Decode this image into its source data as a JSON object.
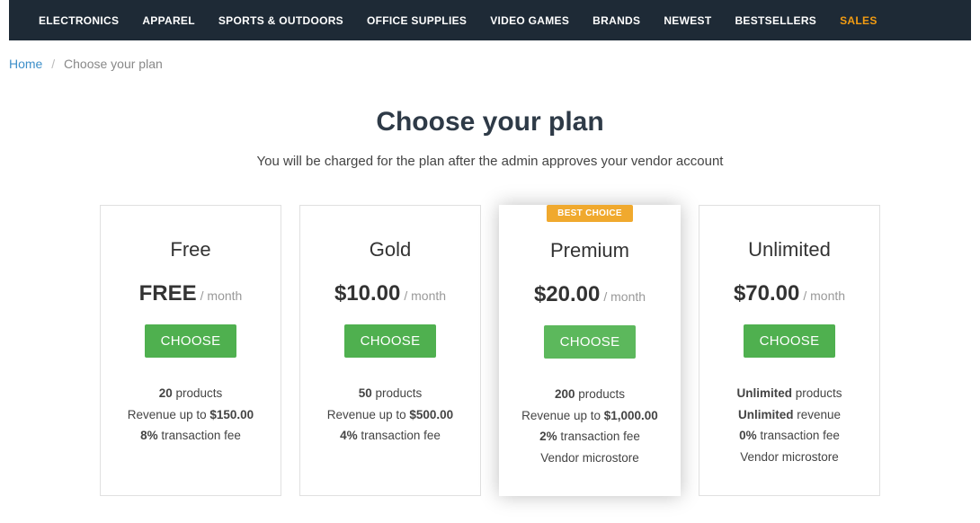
{
  "nav": {
    "items": [
      {
        "label": "ELECTRONICS"
      },
      {
        "label": "APPAREL"
      },
      {
        "label": "SPORTS & OUTDOORS"
      },
      {
        "label": "OFFICE SUPPLIES"
      },
      {
        "label": "VIDEO GAMES"
      },
      {
        "label": "BRANDS"
      },
      {
        "label": "NEWEST"
      },
      {
        "label": "BESTSELLERS"
      },
      {
        "label": "SALES",
        "highlight": true
      }
    ]
  },
  "breadcrumb": {
    "home": "Home",
    "current": "Choose your plan"
  },
  "page": {
    "title": "Choose your plan",
    "subtitle": "You will be charged for the plan after the admin approves your vendor account"
  },
  "plans": [
    {
      "name": "Free",
      "price": "FREE",
      "period": "/ month",
      "choose": "CHOOSE",
      "features": [
        {
          "bold": "20",
          "text": " products"
        },
        {
          "pre": "Revenue up to ",
          "bold": "$150.00"
        },
        {
          "bold": "8%",
          "text": " transaction fee"
        }
      ]
    },
    {
      "name": "Gold",
      "price": "$10.00",
      "period": "/ month",
      "choose": "CHOOSE",
      "features": [
        {
          "bold": "50",
          "text": " products"
        },
        {
          "pre": "Revenue up to ",
          "bold": "$500.00"
        },
        {
          "bold": "4%",
          "text": " transaction fee"
        }
      ]
    },
    {
      "name": "Premium",
      "badge": "BEST CHOICE",
      "price": "$20.00",
      "period": "/ month",
      "choose": "CHOOSE",
      "featured": true,
      "features": [
        {
          "bold": "200",
          "text": " products"
        },
        {
          "pre": "Revenue up to ",
          "bold": "$1,000.00"
        },
        {
          "bold": "2%",
          "text": " transaction fee"
        },
        {
          "plain": "Vendor microstore"
        }
      ]
    },
    {
      "name": "Unlimited",
      "price": "$70.00",
      "period": "/ month",
      "choose": "CHOOSE",
      "features": [
        {
          "bold": "Unlimited",
          "text": " products"
        },
        {
          "bold": "Unlimited",
          "text": " revenue"
        },
        {
          "bold": "0%",
          "text": " transaction fee"
        },
        {
          "plain": "Vendor microstore"
        }
      ]
    }
  ]
}
